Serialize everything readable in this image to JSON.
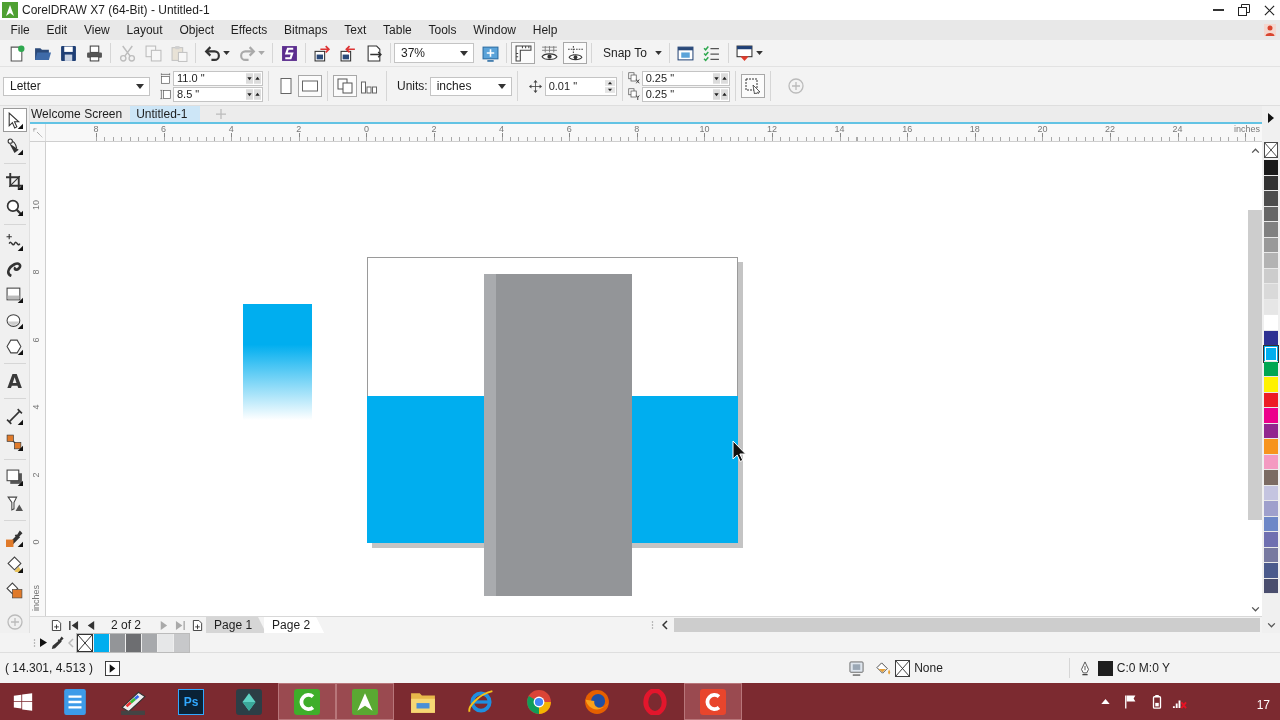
{
  "window": {
    "title": "CorelDRAW X7 (64-Bit) - Untitled-1"
  },
  "menu": [
    "File",
    "Edit",
    "View",
    "Layout",
    "Object",
    "Effects",
    "Bitmaps",
    "Text",
    "Table",
    "Tools",
    "Window",
    "Help"
  ],
  "standard_toolbar": {
    "groups": [
      {
        "buttons": [
          {
            "kind": "new",
            "disabled": false
          },
          {
            "kind": "open",
            "disabled": false
          },
          {
            "kind": "save",
            "disabled": false
          },
          {
            "kind": "print",
            "disabled": false
          }
        ]
      },
      {
        "buttons": [
          {
            "kind": "cut",
            "disabled": true
          },
          {
            "kind": "copy",
            "disabled": true
          },
          {
            "kind": "paste",
            "disabled": true
          }
        ]
      },
      {
        "buttons": [
          {
            "kind": "undo",
            "disabled": false
          },
          {
            "kind": "redo",
            "disabled": true
          }
        ]
      },
      {
        "buttons": [
          {
            "kind": "connect",
            "disabled": false
          }
        ]
      },
      {
        "buttons": [
          {
            "kind": "import",
            "disabled": false
          },
          {
            "kind": "export",
            "disabled": false
          },
          {
            "kind": "pdf",
            "disabled": false
          }
        ]
      }
    ],
    "zoom": "37%",
    "view_groups": [
      {
        "toggles": [
          {
            "kind": "fullscreen",
            "on": false
          }
        ]
      },
      {
        "toggles": [
          {
            "kind": "rulers",
            "on": true
          },
          {
            "kind": "grid",
            "on": false
          },
          {
            "kind": "guidelines",
            "on": true
          }
        ]
      }
    ],
    "snap_to": "Snap To",
    "tail_groups": [
      {
        "buttons": [
          {
            "kind": "options",
            "disabled": false
          },
          {
            "kind": "launcher",
            "disabled": false
          }
        ]
      },
      {
        "buttons": [
          {
            "kind": "welcome",
            "disabled": false
          }
        ]
      }
    ]
  },
  "property_bar": {
    "paper_size": "Letter",
    "page_width": "11.0 \"",
    "page_height": "8.5 \"",
    "orientation": [
      {
        "kind": "portrait",
        "selected": false
      },
      {
        "kind": "landscape",
        "selected": true
      }
    ],
    "page_scope": [
      {
        "kind": "all_pages",
        "selected": true
      },
      {
        "kind": "current_page",
        "selected": false
      }
    ],
    "units_label": "Units:",
    "units": "inches",
    "nudge": "0.01 \"",
    "duplicate_x": "0.25 \"",
    "duplicate_y": "0.25 \"",
    "treat_as_filled": {
      "on": true
    },
    "add_button": {
      "disabled": true
    }
  },
  "document_tabs": [
    {
      "label": "Welcome Screen",
      "selected": false
    },
    {
      "label": "Untitled-1",
      "selected": true
    }
  ],
  "toolbox_groups": [
    {
      "tools": [
        {
          "kind": "pick",
          "selected": true
        },
        {
          "kind": "shape",
          "selected": false
        }
      ]
    },
    {
      "tools": [
        {
          "kind": "crop",
          "selected": false
        },
        {
          "kind": "zoom",
          "selected": false
        }
      ]
    },
    {
      "tools": [
        {
          "kind": "freehand",
          "selected": false
        },
        {
          "kind": "artistic",
          "selected": false
        },
        {
          "kind": "rectangle",
          "selected": false
        },
        {
          "kind": "ellipse",
          "selected": false
        },
        {
          "kind": "polygon",
          "selected": false
        }
      ]
    },
    {
      "tools": [
        {
          "kind": "text",
          "label": "A",
          "selected": false
        }
      ]
    },
    {
      "tools": [
        {
          "kind": "dimension",
          "selected": false
        },
        {
          "kind": "connector",
          "selected": false
        }
      ]
    },
    {
      "tools": [
        {
          "kind": "shadow",
          "selected": false
        },
        {
          "kind": "transparency",
          "selected": false
        }
      ]
    },
    {
      "tools": [
        {
          "kind": "eyedropper",
          "selected": false
        },
        {
          "kind": "fill",
          "selected": false
        },
        {
          "kind": "smartfill",
          "selected": false
        }
      ]
    }
  ],
  "rulers": {
    "horizontal": [
      "8",
      "6",
      "4",
      "2",
      "0",
      "2",
      "4",
      "6",
      "8",
      "10",
      "12",
      "14",
      "16",
      "18",
      "20",
      "22",
      "24"
    ],
    "horizontal_unit": "inches",
    "vertical": [
      "10",
      "8",
      "6",
      "4",
      "2",
      "0"
    ],
    "vertical_unit": "inches"
  },
  "color_palette": [
    {
      "color": "#1a1a1a",
      "selected": false
    },
    {
      "color": "#333333",
      "selected": false
    },
    {
      "color": "#4d4d4d",
      "selected": false
    },
    {
      "color": "#666666",
      "selected": false
    },
    {
      "color": "#808080",
      "selected": false
    },
    {
      "color": "#999999",
      "selected": false
    },
    {
      "color": "#b3b3b3",
      "selected": false
    },
    {
      "color": "#cccccc",
      "selected": false
    },
    {
      "color": "#d9d9d9",
      "selected": false
    },
    {
      "color": "#e6e6e6",
      "selected": false
    },
    {
      "color": "#ffffff",
      "selected": false
    },
    {
      "color": "#2e3192",
      "selected": false
    },
    {
      "color": "#00aeef",
      "selected": true
    },
    {
      "color": "#00a651",
      "selected": false
    },
    {
      "color": "#fff200",
      "selected": false
    },
    {
      "color": "#ed1c24",
      "selected": false
    },
    {
      "color": "#ec008c",
      "selected": false
    },
    {
      "color": "#92278f",
      "selected": false
    },
    {
      "color": "#f7941d",
      "selected": false
    },
    {
      "color": "#f49ac1",
      "selected": false
    },
    {
      "color": "#7b6b63",
      "selected": false
    },
    {
      "color": "#c4c4e0",
      "selected": false
    },
    {
      "color": "#9fa0cc",
      "selected": false
    },
    {
      "color": "#6d87c7",
      "selected": false
    },
    {
      "color": "#6f6fb0",
      "selected": false
    },
    {
      "color": "#7779a0",
      "selected": false
    },
    {
      "color": "#4b5a8c",
      "selected": false
    },
    {
      "color": "#4a4e6e",
      "selected": false
    }
  ],
  "page_navigator": {
    "before": [
      {
        "kind": "addpage",
        "disabled": false
      },
      {
        "kind": "first",
        "disabled": false
      },
      {
        "kind": "prev",
        "disabled": false
      }
    ],
    "counter": "2 of 2",
    "after": [
      {
        "kind": "next",
        "disabled": true
      },
      {
        "kind": "last",
        "disabled": true
      },
      {
        "kind": "addpage",
        "disabled": false
      }
    ],
    "pages": [
      {
        "label": "Page 1",
        "selected": false
      },
      {
        "label": "Page 2",
        "selected": true
      }
    ]
  },
  "document_palette": [
    {
      "color": "#00aeef"
    },
    {
      "color": "#939598"
    },
    {
      "color": "#6d6e71"
    },
    {
      "color": "#a7a9ac"
    },
    {
      "color": "#e6e7e8"
    },
    {
      "color": "#c7c8ca"
    }
  ],
  "status_bar": {
    "coordinates": "( 14.301, 4.513 )",
    "fill": "None",
    "outline": "C:0 M:0 Y"
  },
  "taskbar": {
    "apps": [
      {
        "kind": "notes",
        "active": false
      },
      {
        "kind": "scanner",
        "active": false
      },
      {
        "kind": "photoshop",
        "label": "Ps",
        "active": false
      },
      {
        "kind": "diamond",
        "active": false
      },
      {
        "kind": "camtasia",
        "active": true
      },
      {
        "kind": "corel",
        "active": true
      },
      {
        "kind": "explorer",
        "active": false
      },
      {
        "kind": "ie",
        "active": false
      },
      {
        "kind": "chrome",
        "active": false
      },
      {
        "kind": "firefox",
        "active": false
      },
      {
        "kind": "opera",
        "active": false
      },
      {
        "kind": "screencast",
        "active": true
      }
    ],
    "clock": "17"
  }
}
